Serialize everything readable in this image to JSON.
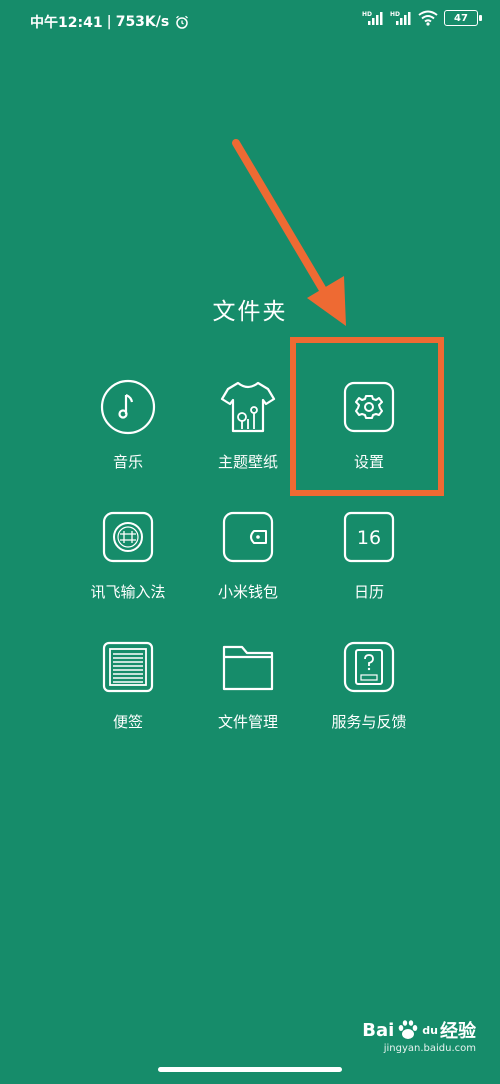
{
  "status_bar": {
    "time": "中午12:41",
    "separator": "|",
    "network_speed": "753K/s",
    "battery": "47",
    "icons": [
      "alarm-icon",
      "signal-hd-icon",
      "signal-hd-icon",
      "wifi-icon",
      "battery-icon"
    ]
  },
  "folder": {
    "title": "文件夹",
    "apps": [
      {
        "label": "音乐",
        "icon": "music-icon"
      },
      {
        "label": "主题壁纸",
        "icon": "theme-shirt-icon"
      },
      {
        "label": "设置",
        "icon": "gear-icon"
      },
      {
        "label": "讯飞输入法",
        "icon": "iflytek-icon"
      },
      {
        "label": "小米钱包",
        "icon": "wallet-icon"
      },
      {
        "label": "日历",
        "icon": "calendar-icon",
        "calendar_day": "16"
      },
      {
        "label": "便签",
        "icon": "notes-icon"
      },
      {
        "label": "文件管理",
        "icon": "folder-icon"
      },
      {
        "label": "服务与反馈",
        "icon": "service-feedback-icon"
      }
    ]
  },
  "annotation": {
    "highlight_color": "#ee6a33",
    "target": "设置"
  },
  "watermark": {
    "brand": "Bai",
    "brand_du": "du",
    "suffix": "经验",
    "url": "jingyan.baidu.com"
  },
  "colors": {
    "background": "#168c6a",
    "foreground": "#ffffff",
    "accent": "#ee6a33"
  }
}
